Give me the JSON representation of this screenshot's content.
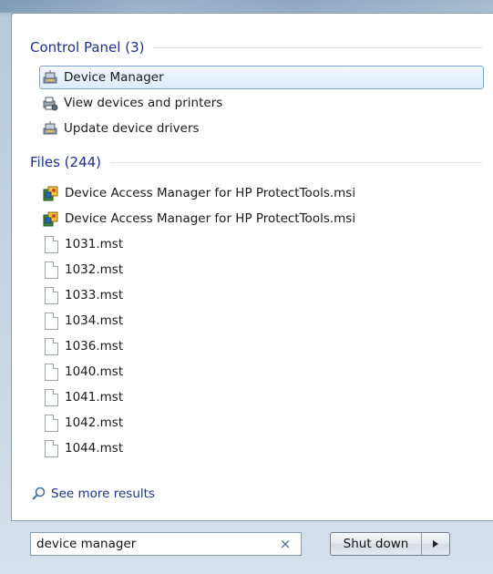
{
  "control_panel": {
    "title": "Control Panel (3)",
    "items": [
      {
        "label": "Device Manager"
      },
      {
        "label": "View devices and printers"
      },
      {
        "label": "Update device drivers"
      }
    ]
  },
  "files": {
    "title": "Files (244)",
    "items": [
      {
        "label": "Device Access Manager for HP ProtectTools.msi"
      },
      {
        "label": "Device Access Manager for HP ProtectTools.msi"
      },
      {
        "label": "1031.mst"
      },
      {
        "label": "1032.mst"
      },
      {
        "label": "1033.mst"
      },
      {
        "label": "1034.mst"
      },
      {
        "label": "1036.mst"
      },
      {
        "label": "1040.mst"
      },
      {
        "label": "1041.mst"
      },
      {
        "label": "1042.mst"
      },
      {
        "label": "1044.mst"
      }
    ]
  },
  "see_more": "See more results",
  "search": {
    "value": "device manager",
    "clear": "×"
  },
  "shutdown": {
    "label": "Shut down"
  }
}
